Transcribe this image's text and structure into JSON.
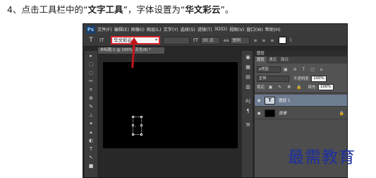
{
  "instruction": {
    "prefix": "4、点击工具栏中的“",
    "bold1": "文字工具",
    "middle": "”，字体设置为“",
    "bold2": "华文彩云",
    "suffix": "”。"
  },
  "app": {
    "logo": "Ps",
    "menu": [
      "文件(F)",
      "编辑(E)",
      "图像(I)",
      "图层(L)",
      "文字(Y)",
      "选择(S)",
      "滤镜(T)",
      "3D(D)",
      "视图(V)",
      "窗口(W)",
      "帮助(H)"
    ]
  },
  "options_bar": {
    "tool_icon": "text-tool-icon",
    "orientation": "IT",
    "font_family": "华文彩云",
    "font_style": "",
    "font_size": "30 点",
    "size_icon": "tT",
    "aa_icon": "aa",
    "aa_value": "锐利",
    "swatch_color": "#ffffff"
  },
  "document_tab": {
    "label": "未标题-1 @ 100% (灰色/8) *"
  },
  "tools": [
    "▸",
    "⬚",
    "◌",
    "✂",
    "⌗",
    "⊕",
    "✎",
    "⊥",
    "✦",
    "▴",
    "◐",
    "T",
    "↖",
    "■"
  ],
  "mid_icons": [
    "▣",
    "▦",
    "▤",
    "▥",
    "A|",
    "¶",
    "⚒"
  ],
  "panel": {
    "header": "图层",
    "tabs": [
      "图层",
      "通道",
      "路径"
    ],
    "filter_select": "ρ类型",
    "filter_icons": "▣ ⊘ T ▢ ⌂",
    "blend_mode": "正常",
    "opacity_label": "不透明度:",
    "opacity_value": "100%",
    "lock_label": "锁定:",
    "lock_icons": "▣ ✎ ✥ 🔒",
    "fill_label": "填充:",
    "fill_value": "100%",
    "layers": [
      {
        "name": "图层 1",
        "thumb": "T",
        "selected": true
      },
      {
        "name": "背景",
        "thumb": "",
        "selected": false
      }
    ]
  },
  "watermark": "最需教育",
  "colors": {
    "highlight": "#d7262d",
    "arrow": "#c2151d",
    "watermark": "#1d2fa0"
  }
}
